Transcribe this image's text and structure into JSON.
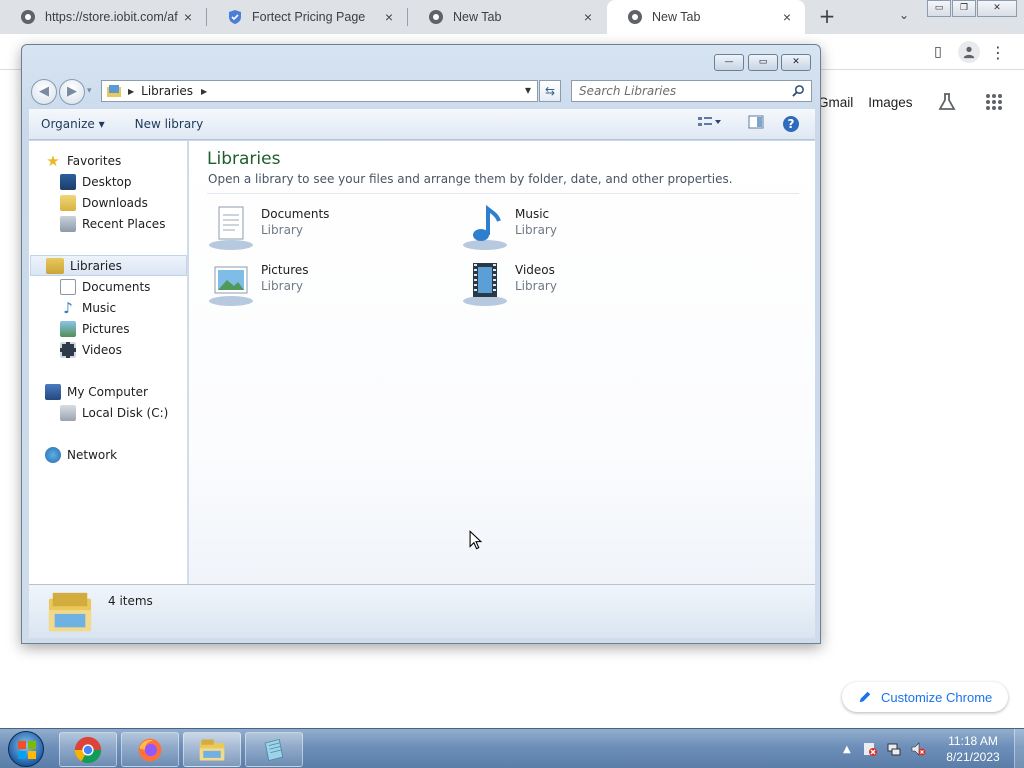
{
  "browser": {
    "tabs": [
      {
        "title": "https://store.iobit.com/af",
        "close": "×"
      },
      {
        "title": "Fortect Pricing Page",
        "close": "×"
      },
      {
        "title": "New Tab",
        "close": "×"
      },
      {
        "title": "New Tab",
        "close": "×",
        "active": true
      }
    ],
    "new_tab_symbol": "+",
    "tab_menu_symbol": "⌄",
    "links": {
      "gmail": "Gmail",
      "images": "Images"
    },
    "customize_label": "Customize Chrome"
  },
  "explorer": {
    "title_controls": {
      "minimize": "—",
      "maximize": "▭",
      "close": "✕"
    },
    "address": {
      "root_arrow": "▶",
      "path": "Libraries",
      "path_arrow": "▶",
      "dropdown": "▾"
    },
    "search": {
      "placeholder": "Search Libraries"
    },
    "commands": {
      "organize": "Organize ▾",
      "new_library": "New library"
    },
    "nav": {
      "favorites": {
        "label": "Favorites",
        "items": [
          "Desktop",
          "Downloads",
          "Recent Places"
        ]
      },
      "libraries": {
        "label": "Libraries",
        "items": [
          "Documents",
          "Music",
          "Pictures",
          "Videos"
        ]
      },
      "computer": {
        "label": "My Computer",
        "items": [
          "Local Disk (C:)"
        ]
      },
      "network": {
        "label": "Network"
      }
    },
    "content": {
      "title": "Libraries",
      "subtitle": "Open a library to see your files and arrange them by folder, date, and other properties.",
      "libraries": [
        {
          "name": "Documents",
          "type": "Library",
          "icon": "documents-library-icon"
        },
        {
          "name": "Music",
          "type": "Library",
          "icon": "music-library-icon"
        },
        {
          "name": "Pictures",
          "type": "Library",
          "icon": "pictures-library-icon"
        },
        {
          "name": "Videos",
          "type": "Library",
          "icon": "videos-library-icon"
        }
      ]
    },
    "details": {
      "item_count": "4 items"
    }
  },
  "taskbar": {
    "clock_time": "11:18 AM",
    "clock_date": "8/21/2023",
    "pinned": [
      "chrome-icon",
      "firefox-icon",
      "explorer-icon",
      "notepad-icon"
    ]
  }
}
